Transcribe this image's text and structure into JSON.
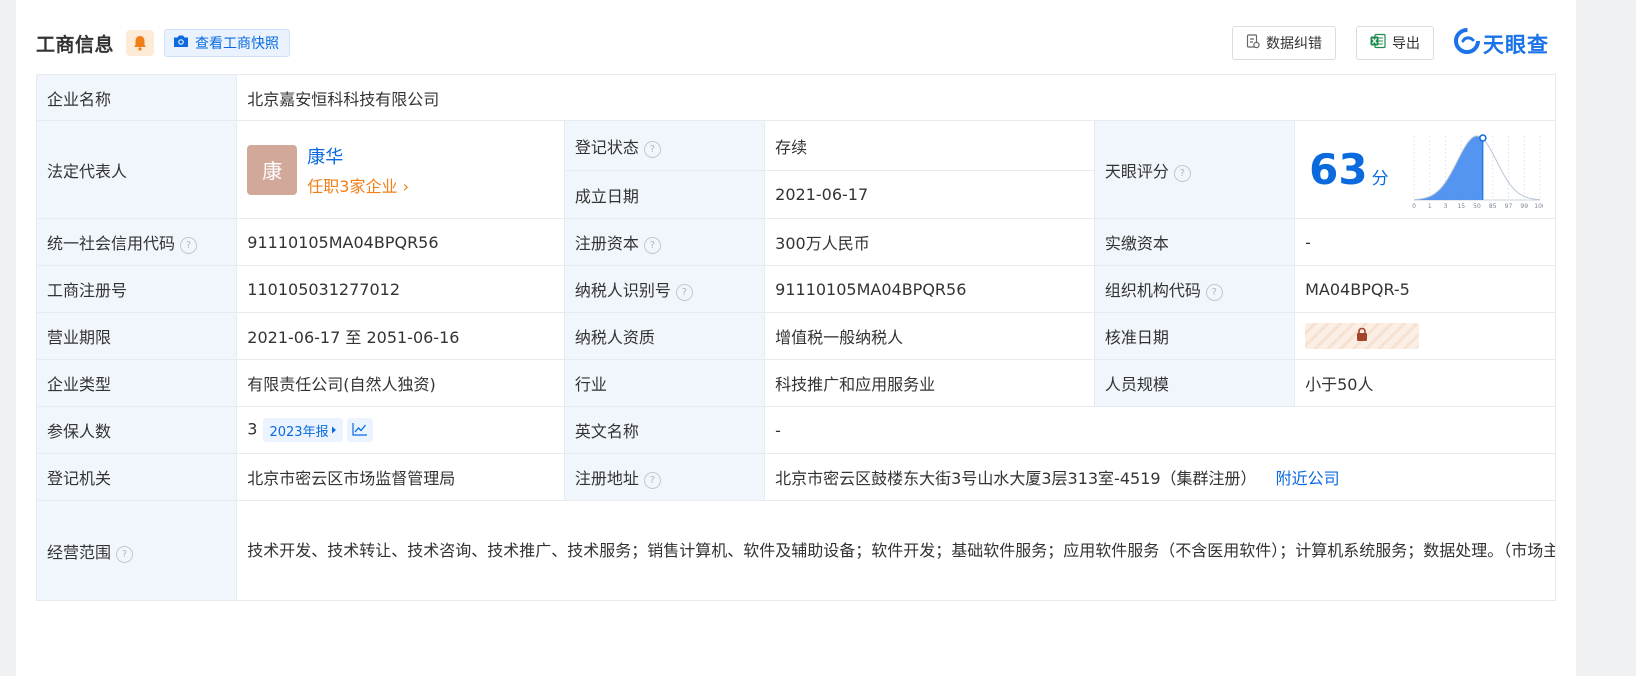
{
  "header": {
    "title": "工商信息",
    "snapshot_label": "查看工商快照",
    "correct_label": "数据纠错",
    "export_label": "导出",
    "logo_text": "天眼查"
  },
  "company": {
    "name_label": "企业名称",
    "name": "北京嘉安恒科科技有限公司"
  },
  "legal_rep": {
    "label": "法定代表人",
    "avatar_char": "康",
    "name": "康华",
    "positions": "任职3家企业",
    "chevron": "›"
  },
  "status": {
    "label": "登记状态",
    "value": "存续"
  },
  "founded": {
    "label": "成立日期",
    "value": "2021-06-17"
  },
  "score": {
    "label": "天眼评分",
    "value": "63",
    "unit": "分"
  },
  "score_chart": {
    "x_ticks": [
      "0",
      "1",
      "3",
      "15",
      "50",
      "85",
      "97",
      "99",
      "100"
    ],
    "marker_tick": "63"
  },
  "credit_code": {
    "label": "统一社会信用代码",
    "value": "91110105MA04BPQR56"
  },
  "registered_capital": {
    "label": "注册资本",
    "value": "300万人民币"
  },
  "paid_capital": {
    "label": "实缴资本",
    "value": "-"
  },
  "reg_number": {
    "label": "工商注册号",
    "value": "110105031277012"
  },
  "taxpayer_id": {
    "label": "纳税人识别号",
    "value": "91110105MA04BPQR56"
  },
  "org_code": {
    "label": "组织机构代码",
    "value": "MA04BPQR-5"
  },
  "term": {
    "label": "营业期限",
    "value": "2021-06-17 至 2051-06-16"
  },
  "taxpayer_qual": {
    "label": "纳税人资质",
    "value": "增值税一般纳税人"
  },
  "approval_date": {
    "label": "核准日期"
  },
  "company_type": {
    "label": "企业类型",
    "value": "有限责任公司(自然人独资)"
  },
  "industry": {
    "label": "行业",
    "value": "科技推广和应用服务业"
  },
  "staff_size": {
    "label": "人员规模",
    "value": "小于50人"
  },
  "insured": {
    "label": "参保人数",
    "value": "3",
    "report": "2023年报"
  },
  "english_name": {
    "label": "英文名称",
    "value": "-"
  },
  "authority": {
    "label": "登记机关",
    "value": "北京市密云区市场监督管理局"
  },
  "address": {
    "label": "注册地址",
    "value": "北京市密云区鼓楼东大街3号山水大厦3层313室-4519（集群注册）",
    "nearby": "附近公司"
  },
  "scope": {
    "label": "经营范围",
    "value": "技术开发、技术转让、技术咨询、技术推广、技术服务；销售计算机、软件及辅助设备；软件开发；基础软件服务；应用软件服务（不含医用软件）；计算机系统服务；数据处理。（市场主体依法自主选择经营项目，开展经营活动；依法须经批准的项目，经相关部门批准后依批准的内容开展经营活动；不得从事国家和本市产业政策禁止和限制类项目的经营活动。）"
  },
  "help_icon": "?",
  "colors": {
    "primary": "#0b6bde",
    "status_green": "#0bab5f",
    "orange": "#f07f18",
    "label_bg": "#f1f6fc"
  }
}
